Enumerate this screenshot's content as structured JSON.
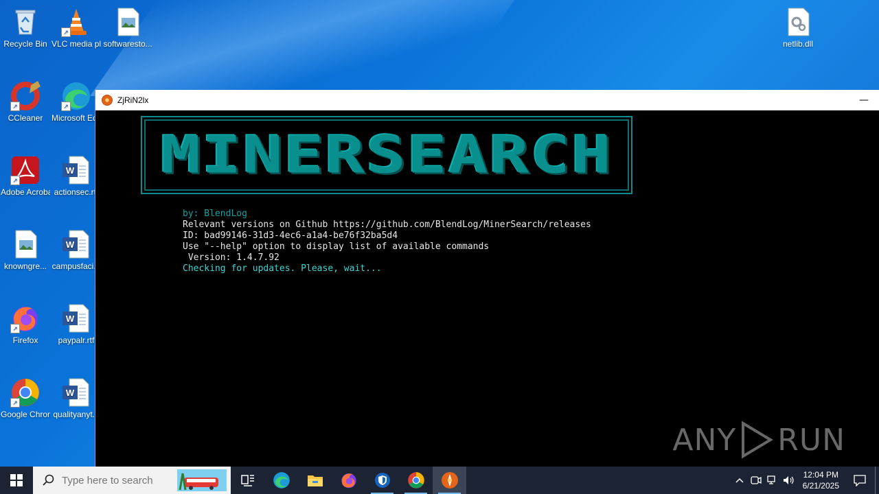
{
  "desktop": {
    "icons": [
      {
        "label": "Recycle Bin"
      },
      {
        "label": "VLC media player"
      },
      {
        "label": "softwaresto..."
      },
      {
        "label": "CCleaner"
      },
      {
        "label": "Microsoft Edge"
      },
      {
        "label": "Adobe Acrobat"
      },
      {
        "label": "actionsec.rtf"
      },
      {
        "label": "knowngre..."
      },
      {
        "label": "campusfaci..."
      },
      {
        "label": "Firefox"
      },
      {
        "label": "paypalr.rtf"
      },
      {
        "label": "Google Chrome"
      },
      {
        "label": "qualityanyt..."
      },
      {
        "label": "netlib.dll"
      }
    ]
  },
  "window": {
    "title": "ZjRiN2lx",
    "minimize": "—",
    "banner": "MINERSEARCH",
    "lines": {
      "by": "by: BlendLog",
      "versions": "Relevant versions on Github https://github.com/BlendLog/MinerSearch/releases",
      "id": "ID: bad99146-31d3-4ec6-a1a4-be76f32ba5d4",
      "help": "Use \"--help\" option to display list of available commands",
      "version": " Version: 1.4.7.92",
      "checking": "Checking for updates. Please, wait..."
    }
  },
  "watermark": {
    "left": "ANY",
    "right": "RUN"
  },
  "taskbar": {
    "search_placeholder": "Type here to search",
    "time": "12:04 PM",
    "date": "6/21/2025"
  },
  "colors": {
    "desktop": "#0a74da",
    "console_bg": "#000000",
    "banner": "#0a8f8f",
    "teal_text": "#0fa3a3",
    "cyan_text": "#3ad6d6",
    "taskbar": "#1c2433"
  }
}
